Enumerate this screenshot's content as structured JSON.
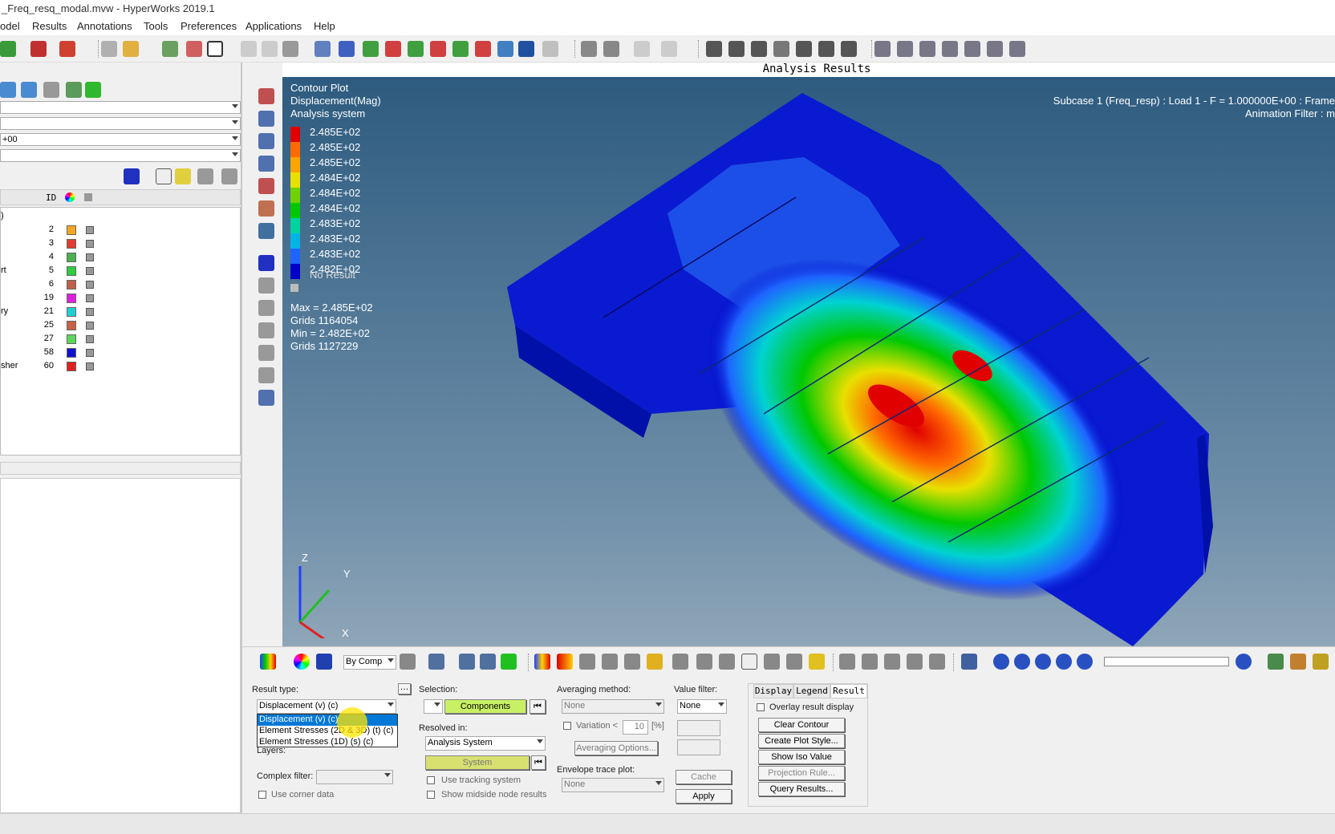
{
  "window": {
    "title": "_Freq_resq_modal.mvw - HyperWorks 2019.1"
  },
  "menu": [
    "odel",
    "Results",
    "Annotations",
    "Tools",
    "Preferences",
    "Applications",
    "Help"
  ],
  "left_panel": {
    "combo3_value": "+00",
    "tree": {
      "header_id": "ID",
      "rows": [
        {
          "name": ")",
          "id": "",
          "color": ""
        },
        {
          "name": "",
          "id": "2",
          "color": "#f5a623"
        },
        {
          "name": "",
          "id": "3",
          "color": "#e03c31"
        },
        {
          "name": "",
          "id": "4",
          "color": "#4caf50"
        },
        {
          "name": "rt",
          "id": "5",
          "color": "#2ecc40"
        },
        {
          "name": "",
          "id": "6",
          "color": "#c0604a"
        },
        {
          "name": "",
          "id": "19",
          "color": "#e020e0"
        },
        {
          "name": "ry",
          "id": "21",
          "color": "#20d0d0"
        },
        {
          "name": "",
          "id": "25",
          "color": "#c86048"
        },
        {
          "name": "",
          "id": "27",
          "color": "#5cd65c"
        },
        {
          "name": "",
          "id": "58",
          "color": "#1010d0"
        },
        {
          "name": "sher",
          "id": "60",
          "color": "#e02020"
        }
      ]
    }
  },
  "viewport": {
    "title": "Analysis Results",
    "legend": {
      "title": "Contour Plot",
      "result": "Displacement(Mag)",
      "system": "Analysis system",
      "values": [
        "2.485E+02",
        "2.485E+02",
        "2.485E+02",
        "2.484E+02",
        "2.484E+02",
        "2.484E+02",
        "2.483E+02",
        "2.483E+02",
        "2.483E+02",
        "2.482E+02"
      ],
      "colors": [
        "#e00000",
        "#ff6a00",
        "#ffa500",
        "#e8e000",
        "#6ed200",
        "#00c800",
        "#00d2a0",
        "#00b4e6",
        "#1e64ff",
        "#0000c8"
      ],
      "no_result": "No Result",
      "max": "Max = 2.485E+02",
      "max_grid": "Grids 1164054",
      "min": "Min = 2.482E+02",
      "min_grid": "Grids 1127229"
    },
    "subcase": "Subcase 1 (Freq_resp) : Load 1 - F = 1.000000E+00 : Frame",
    "anim_filter": "Animation Filter : m",
    "axes": {
      "x": "X",
      "y": "Y",
      "z": "Z"
    }
  },
  "toolbar2": {
    "by_comp": "By Comp"
  },
  "bottom": {
    "result_type_label": "Result type:",
    "result_type_value": "Displacement (v) (c)",
    "dropdown_options": [
      "Displacement (v) (c)",
      "Element Stresses (2D & 3D) (t) (c)",
      "Element Stresses (1D) (s) (c)"
    ],
    "layers_label": "Layers:",
    "complex_filter_label": "Complex filter:",
    "use_corner_data": "Use corner data",
    "selection_label": "Selection:",
    "components_btn": "Components",
    "resolved_in_label": "Resolved in:",
    "resolved_in_value": "Analysis System",
    "system_btn": "System",
    "use_tracking": "Use tracking system",
    "show_midside": "Show midside node results",
    "averaging_label": "Averaging method:",
    "averaging_value": "None",
    "variation_label": "Variation <",
    "variation_value": "10",
    "variation_unit": "[%]",
    "averaging_options": "Averaging Options...",
    "envelope_label": "Envelope trace plot:",
    "envelope_value": "None",
    "value_filter_label": "Value filter:",
    "value_filter_value": "None",
    "cache_btn": "Cache",
    "apply_btn": "Apply",
    "tabs": [
      "Display",
      "Legend",
      "Result"
    ],
    "overlay": "Overlay result display",
    "clear_contour": "Clear Contour",
    "create_plot_style": "Create Plot Style...",
    "show_iso": "Show Iso Value",
    "projection_rule": "Projection Rule...",
    "query_results": "Query Results..."
  }
}
